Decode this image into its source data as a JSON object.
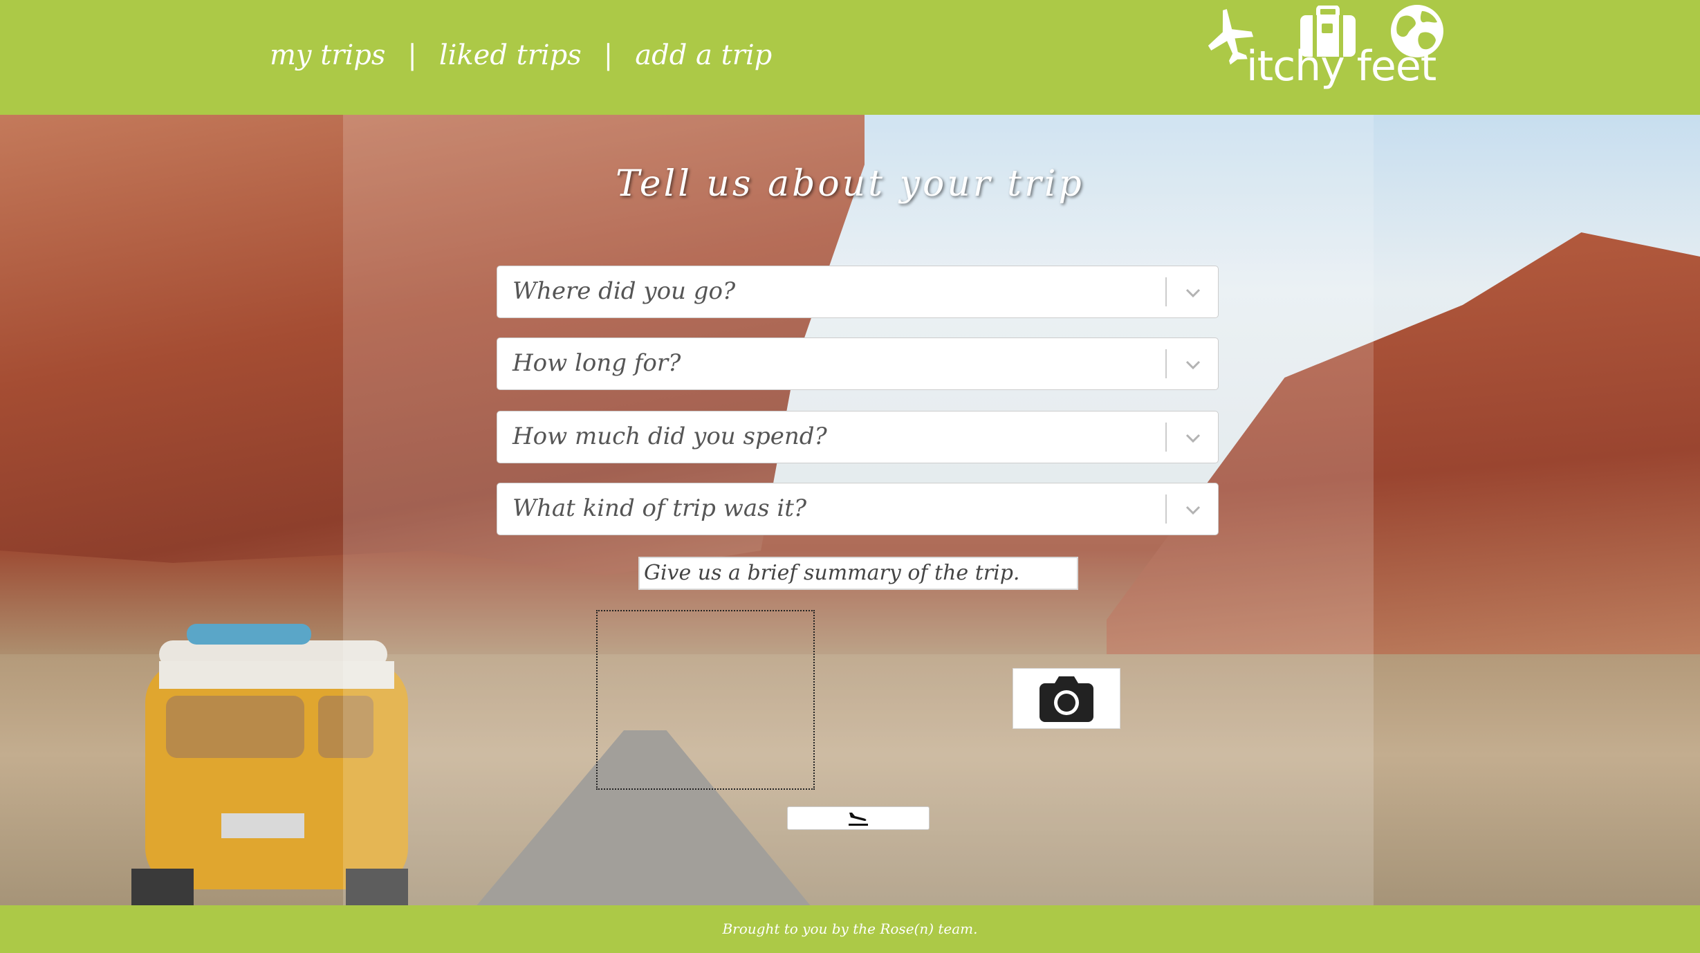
{
  "nav": {
    "items": [
      {
        "label": "my trips"
      },
      {
        "label": "liked trips"
      },
      {
        "label": "add a trip"
      }
    ],
    "separator": "|"
  },
  "logo": {
    "text": "itchy feet",
    "icons": [
      "airplane-icon",
      "suitcase-icon",
      "globe-icon"
    ]
  },
  "form": {
    "title": "Tell us about your trip",
    "selects": [
      {
        "placeholder": "Where did you go?"
      },
      {
        "placeholder": "How long for?"
      },
      {
        "placeholder": "How much did you spend?"
      },
      {
        "placeholder": "What kind of trip was it?"
      }
    ],
    "summary_placeholder": "Give us a brief summary of the trip.",
    "camera_icon": "camera-icon",
    "submit_icon": "plane-landing-icon"
  },
  "footer": {
    "text": "Brought to you by the Rose(n) team."
  },
  "colors": {
    "brand_green": "#acc947",
    "white": "#ffffff"
  }
}
